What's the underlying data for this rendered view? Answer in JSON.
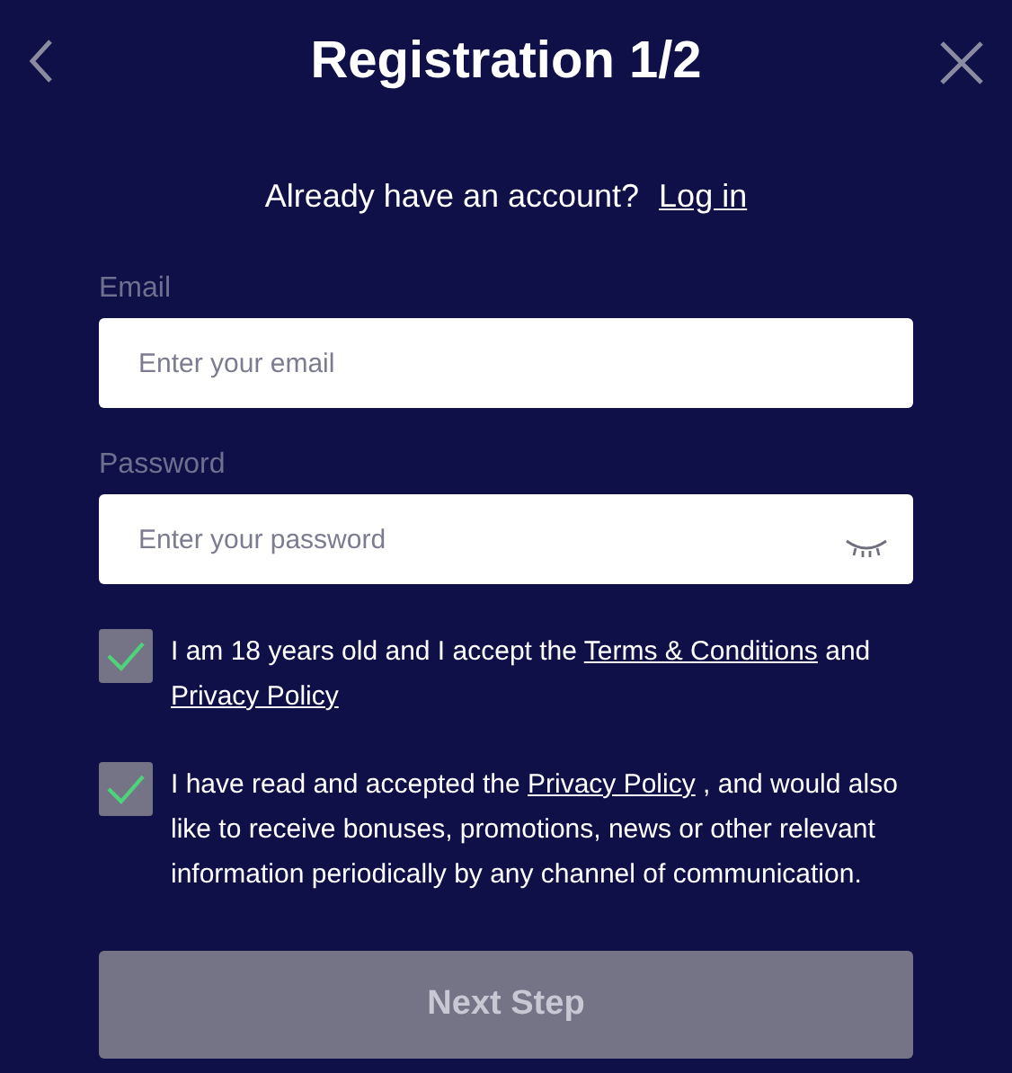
{
  "title": "Registration 1/2",
  "login_prompt": {
    "text": "Already have an account?",
    "link": "Log in"
  },
  "fields": [
    {
      "label": "Email",
      "placeholder": "Enter your email",
      "kind": "email"
    },
    {
      "label": "Password",
      "placeholder": "Enter your password",
      "kind": "password"
    }
  ],
  "consents": [
    {
      "checked": true,
      "parts": [
        {
          "kind": "text",
          "text": "I am 18 years old and I accept the "
        },
        {
          "kind": "link",
          "text": "Terms & Conditions"
        },
        {
          "kind": "text",
          "text": " and "
        },
        {
          "kind": "link",
          "text": "Privacy Policy"
        }
      ]
    },
    {
      "checked": true,
      "parts": [
        {
          "kind": "text",
          "text": "I have read and accepted the "
        },
        {
          "kind": "link",
          "text": "Privacy Policy"
        },
        {
          "kind": "text",
          "text": " , and would also like to receive bonuses, promotions, news or other relevant information periodically by any channel of communication."
        }
      ]
    }
  ],
  "next_button": {
    "label": "Next Step",
    "disabled": true
  }
}
